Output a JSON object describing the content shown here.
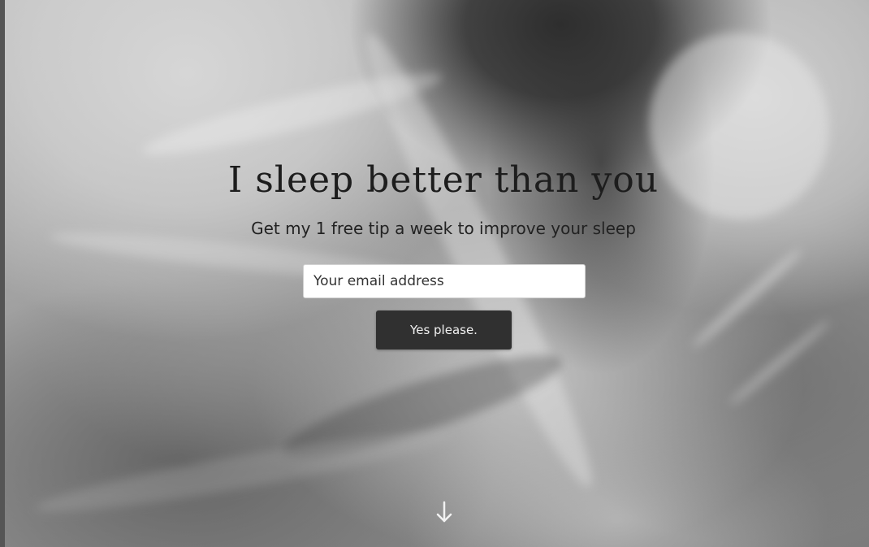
{
  "hero": {
    "title": "I sleep better than you",
    "subtitle": "Get my 1 free tip a week to improve your sleep",
    "email_placeholder": "Your email address",
    "email_value": "",
    "submit_label": "Yes please.",
    "scroll_icon": "arrow-down-icon"
  },
  "colors": {
    "button_background": "#303030",
    "button_text": "#f0f0f0",
    "title_text": "#1d1d1d"
  }
}
